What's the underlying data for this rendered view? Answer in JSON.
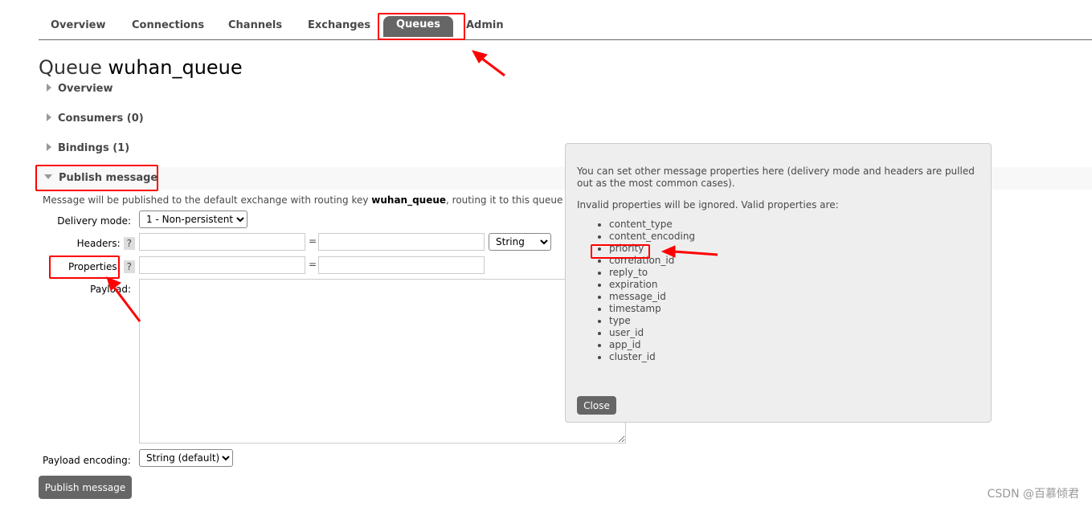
{
  "nav": {
    "tabs": [
      {
        "label": "Overview"
      },
      {
        "label": "Connections"
      },
      {
        "label": "Channels"
      },
      {
        "label": "Exchanges"
      },
      {
        "label": "Queues",
        "active": true
      },
      {
        "label": "Admin"
      }
    ]
  },
  "page": {
    "title_prefix": "Queue",
    "queue_name": "wuhan_queue"
  },
  "sections": [
    {
      "label": "Overview"
    },
    {
      "label": "Consumers (0)"
    },
    {
      "label": "Bindings (1)"
    },
    {
      "label": "Publish message",
      "expanded": true
    }
  ],
  "publish": {
    "note_prefix": "Message will be published to the default exchange with routing key ",
    "routing_key": "wuhan_queue",
    "note_suffix": ", routing it to this queue",
    "delivery_mode_label": "Delivery mode:",
    "delivery_mode_value": "1 - Non-persistent",
    "headers_label": "Headers:",
    "help": "?",
    "equals": "=",
    "header_type": "String",
    "properties_label": "Properties:",
    "payload_label": "Payload:",
    "payload_encoding_label": "Payload encoding:",
    "payload_encoding_value": "String (default)",
    "submit_label": "Publish message"
  },
  "popup": {
    "text1": "You can set other message properties here (delivery mode and headers are pulled out as the most common cases).",
    "text2": "Invalid properties will be ignored. Valid properties are:",
    "properties": [
      "content_type",
      "content_encoding",
      "priority",
      "correlation_id",
      "reply_to",
      "expiration",
      "message_id",
      "timestamp",
      "type",
      "user_id",
      "app_id",
      "cluster_id"
    ],
    "close_label": "Close"
  },
  "annotation_color": "#ff0000",
  "watermark": "CSDN @百慕倾君"
}
